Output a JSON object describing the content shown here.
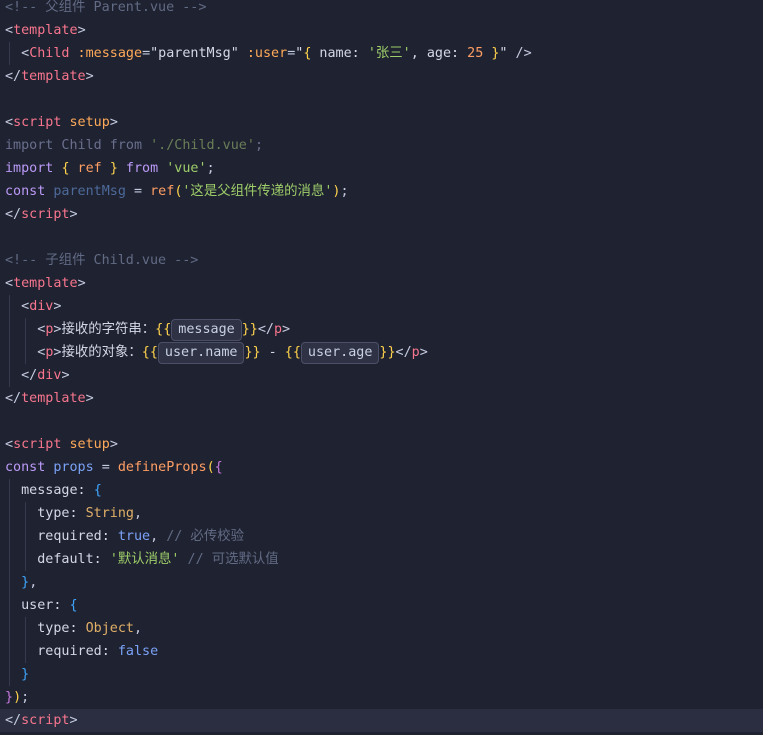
{
  "editor": {
    "lines": [
      [
        {
          "t": "<!-- 父组件 Parent.vue -->",
          "c": "tok-comment"
        }
      ],
      [
        {
          "t": "<",
          "c": "tok-bracket"
        },
        {
          "t": "template",
          "c": "tok-tag"
        },
        {
          "t": ">",
          "c": "tok-bracket"
        }
      ],
      [
        {
          "t": "  ",
          "c": "tok-text"
        },
        {
          "t": "<",
          "c": "tok-bracket"
        },
        {
          "t": "Child",
          "c": "tok-tag"
        },
        {
          "t": " :message",
          "c": "tok-attr"
        },
        {
          "t": "=",
          "c": "tok-op"
        },
        {
          "t": "\"parentMsg\"",
          "c": "tok-text"
        },
        {
          "t": " :user",
          "c": "tok-attr"
        },
        {
          "t": "=",
          "c": "tok-op"
        },
        {
          "t": "\"",
          "c": "tok-text"
        },
        {
          "t": "{",
          "c": "tok-brace"
        },
        {
          "t": " name: ",
          "c": "tok-key"
        },
        {
          "t": "'张三'",
          "c": "tok-string"
        },
        {
          "t": ", age: ",
          "c": "tok-key"
        },
        {
          "t": "25",
          "c": "tok-number"
        },
        {
          "t": " }",
          "c": "tok-brace"
        },
        {
          "t": "\"",
          "c": "tok-text"
        },
        {
          "t": " />",
          "c": "tok-bracket"
        }
      ],
      [
        {
          "t": "</",
          "c": "tok-bracket"
        },
        {
          "t": "template",
          "c": "tok-tag"
        },
        {
          "t": ">",
          "c": "tok-bracket"
        }
      ],
      [],
      [
        {
          "t": "<",
          "c": "tok-bracket"
        },
        {
          "t": "script",
          "c": "tok-tag"
        },
        {
          "t": " setup",
          "c": "tok-attr"
        },
        {
          "t": ">",
          "c": "tok-bracket"
        }
      ],
      [
        {
          "t": "import",
          "c": "tok-keyword-dim"
        },
        {
          "t": " Child",
          "c": "tok-ident-dim"
        },
        {
          "t": " from",
          "c": "tok-keyword-dim"
        },
        {
          "t": " './Child.vue'",
          "c": "tok-string-dim"
        },
        {
          "t": ";",
          "c": "tok-punct-dim"
        }
      ],
      [
        {
          "t": "import",
          "c": "tok-keyword"
        },
        {
          "t": " ",
          "c": "tok-text"
        },
        {
          "t": "{",
          "c": "tok-brace"
        },
        {
          "t": " ref ",
          "c": "tok-func"
        },
        {
          "t": "}",
          "c": "tok-brace"
        },
        {
          "t": " from ",
          "c": "tok-keyword"
        },
        {
          "t": "'vue'",
          "c": "tok-string"
        },
        {
          "t": ";",
          "c": "tok-punct"
        }
      ],
      [
        {
          "t": "const",
          "c": "tok-keyword"
        },
        {
          "t": " parentMsg",
          "c": "tok-var-dim"
        },
        {
          "t": " = ",
          "c": "tok-op"
        },
        {
          "t": "ref",
          "c": "tok-func"
        },
        {
          "t": "(",
          "c": "tok-brace"
        },
        {
          "t": "'这是父组件传递的消息'",
          "c": "tok-string"
        },
        {
          "t": ")",
          "c": "tok-brace"
        },
        {
          "t": ";",
          "c": "tok-punct"
        }
      ],
      [
        {
          "t": "</",
          "c": "tok-bracket"
        },
        {
          "t": "script",
          "c": "tok-tag"
        },
        {
          "t": ">",
          "c": "tok-bracket"
        }
      ],
      [],
      [
        {
          "t": "<!-- 子组件 Child.vue -->",
          "c": "tok-comment"
        }
      ],
      [
        {
          "t": "<",
          "c": "tok-bracket"
        },
        {
          "t": "template",
          "c": "tok-tag"
        },
        {
          "t": ">",
          "c": "tok-bracket"
        }
      ],
      [
        {
          "t": "  ",
          "c": "tok-text"
        },
        {
          "t": "<",
          "c": "tok-bracket"
        },
        {
          "t": "div",
          "c": "tok-tag"
        },
        {
          "t": ">",
          "c": "tok-bracket"
        }
      ],
      [
        {
          "t": "    ",
          "c": "tok-text"
        },
        {
          "t": "<",
          "c": "tok-bracket"
        },
        {
          "t": "p",
          "c": "tok-tag"
        },
        {
          "t": ">",
          "c": "tok-bracket"
        },
        {
          "t": "接收的字符串：",
          "c": "tok-text"
        },
        {
          "t": "{{",
          "c": "tok-brace"
        },
        {
          "chip": "message"
        },
        {
          "t": "}}",
          "c": "tok-brace"
        },
        {
          "t": "</",
          "c": "tok-bracket"
        },
        {
          "t": "p",
          "c": "tok-tag"
        },
        {
          "t": ">",
          "c": "tok-bracket"
        }
      ],
      [
        {
          "t": "    ",
          "c": "tok-text"
        },
        {
          "t": "<",
          "c": "tok-bracket"
        },
        {
          "t": "p",
          "c": "tok-tag"
        },
        {
          "t": ">",
          "c": "tok-bracket"
        },
        {
          "t": "接收的对象：",
          "c": "tok-text"
        },
        {
          "t": "{{",
          "c": "tok-brace"
        },
        {
          "chip": "user.name"
        },
        {
          "t": "}}",
          "c": "tok-brace"
        },
        {
          "t": " - ",
          "c": "tok-text"
        },
        {
          "t": "{{",
          "c": "tok-brace"
        },
        {
          "chip": "user.age"
        },
        {
          "t": "}}",
          "c": "tok-brace"
        },
        {
          "t": "</",
          "c": "tok-bracket"
        },
        {
          "t": "p",
          "c": "tok-tag"
        },
        {
          "t": ">",
          "c": "tok-bracket"
        }
      ],
      [
        {
          "t": "  ",
          "c": "tok-text"
        },
        {
          "t": "</",
          "c": "tok-bracket"
        },
        {
          "t": "div",
          "c": "tok-tag"
        },
        {
          "t": ">",
          "c": "tok-bracket"
        }
      ],
      [
        {
          "t": "</",
          "c": "tok-bracket"
        },
        {
          "t": "template",
          "c": "tok-tag"
        },
        {
          "t": ">",
          "c": "tok-bracket"
        }
      ],
      [],
      [
        {
          "t": "<",
          "c": "tok-bracket"
        },
        {
          "t": "script",
          "c": "tok-tag"
        },
        {
          "t": " setup",
          "c": "tok-attr"
        },
        {
          "t": ">",
          "c": "tok-bracket"
        }
      ],
      [
        {
          "t": "const",
          "c": "tok-keyword"
        },
        {
          "t": " props",
          "c": "tok-var"
        },
        {
          "t": " = ",
          "c": "tok-op"
        },
        {
          "t": "defineProps",
          "c": "tok-func"
        },
        {
          "t": "(",
          "c": "tok-brace"
        },
        {
          "t": "{",
          "c": "tok-brace2"
        }
      ],
      [
        {
          "t": "  message: ",
          "c": "tok-key"
        },
        {
          "t": "{",
          "c": "tok-brace3"
        }
      ],
      [
        {
          "t": "    type: ",
          "c": "tok-key"
        },
        {
          "t": "String",
          "c": "tok-type"
        },
        {
          "t": ",",
          "c": "tok-punct"
        }
      ],
      [
        {
          "t": "    required: ",
          "c": "tok-key"
        },
        {
          "t": "true",
          "c": "tok-bool"
        },
        {
          "t": ",",
          "c": "tok-punct"
        },
        {
          "t": " // 必传校验",
          "c": "tok-comment"
        }
      ],
      [
        {
          "t": "    default: ",
          "c": "tok-key"
        },
        {
          "t": "'默认消息'",
          "c": "tok-string"
        },
        {
          "t": " // 可选默认值",
          "c": "tok-comment"
        }
      ],
      [
        {
          "t": "  ",
          "c": "tok-text"
        },
        {
          "t": "}",
          "c": "tok-brace3"
        },
        {
          "t": ",",
          "c": "tok-punct"
        }
      ],
      [
        {
          "t": "  user: ",
          "c": "tok-key"
        },
        {
          "t": "{",
          "c": "tok-brace3"
        }
      ],
      [
        {
          "t": "    type: ",
          "c": "tok-key"
        },
        {
          "t": "Object",
          "c": "tok-type"
        },
        {
          "t": ",",
          "c": "tok-punct"
        }
      ],
      [
        {
          "t": "    required: ",
          "c": "tok-key"
        },
        {
          "t": "false",
          "c": "tok-bool"
        }
      ],
      [
        {
          "t": "  ",
          "c": "tok-text"
        },
        {
          "t": "}",
          "c": "tok-brace3"
        }
      ],
      [
        {
          "t": "}",
          "c": "tok-brace2"
        },
        {
          "t": ")",
          "c": "tok-brace"
        },
        {
          "t": ";",
          "c": "tok-punct"
        }
      ],
      [
        {
          "t": "</",
          "c": "tok-bracket"
        },
        {
          "t": "script",
          "c": "tok-tag"
        },
        {
          "t": ">",
          "c": "tok-bracket"
        }
      ]
    ],
    "current_line": 31,
    "colors": {
      "background": "#1f2230",
      "current_line": "#2a2e40",
      "tag": "#f7768e",
      "string": "#9ece6a",
      "keyword": "#bb9af7",
      "comment": "#626b85"
    }
  }
}
